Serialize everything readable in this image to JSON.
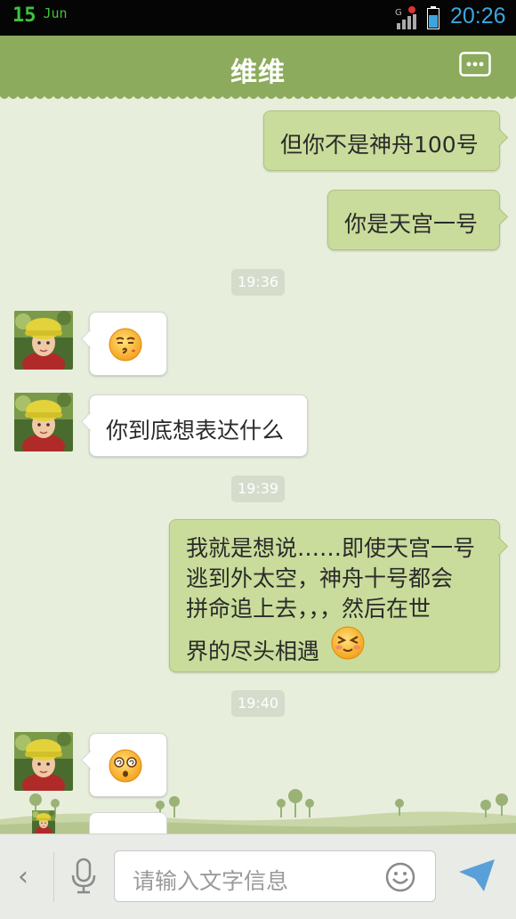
{
  "status_bar": {
    "date_day": "15",
    "date_month": "Jun",
    "time": "20:26"
  },
  "header": {
    "title": "维维",
    "menu_icon": "more-icon"
  },
  "messages": [
    {
      "type": "out",
      "text": "但你不是神舟100号"
    },
    {
      "type": "out",
      "text": "你是天宫一号"
    },
    {
      "type": "time",
      "text": "19:36"
    },
    {
      "type": "in",
      "emoji": "kiss-face-emoji"
    },
    {
      "type": "in",
      "text": "你到底想表达什么"
    },
    {
      "type": "time",
      "text": "19:39"
    },
    {
      "type": "out",
      "lines": [
        "我就是想说……即使天宫一号",
        "逃到外太空，神舟十号都会",
        "拼命追上去，，，然后在世",
        "界的尽头相遇"
      ],
      "emoji": "squint-face-emoji"
    },
    {
      "type": "time",
      "text": "19:40"
    },
    {
      "type": "in",
      "emoji": "dizzy-face-emoji"
    }
  ],
  "input_bar": {
    "placeholder": "请输入文字信息",
    "icons": [
      "back-icon",
      "mic-icon",
      "emoji-icon",
      "send-icon"
    ]
  },
  "colors": {
    "header": "#8cab5c",
    "outgoing_bubble": "#c9dc9b",
    "incoming_bubble": "#ffffff",
    "background": "#e8eedc",
    "clock": "#3aa6e0",
    "date": "#3ec23e"
  }
}
